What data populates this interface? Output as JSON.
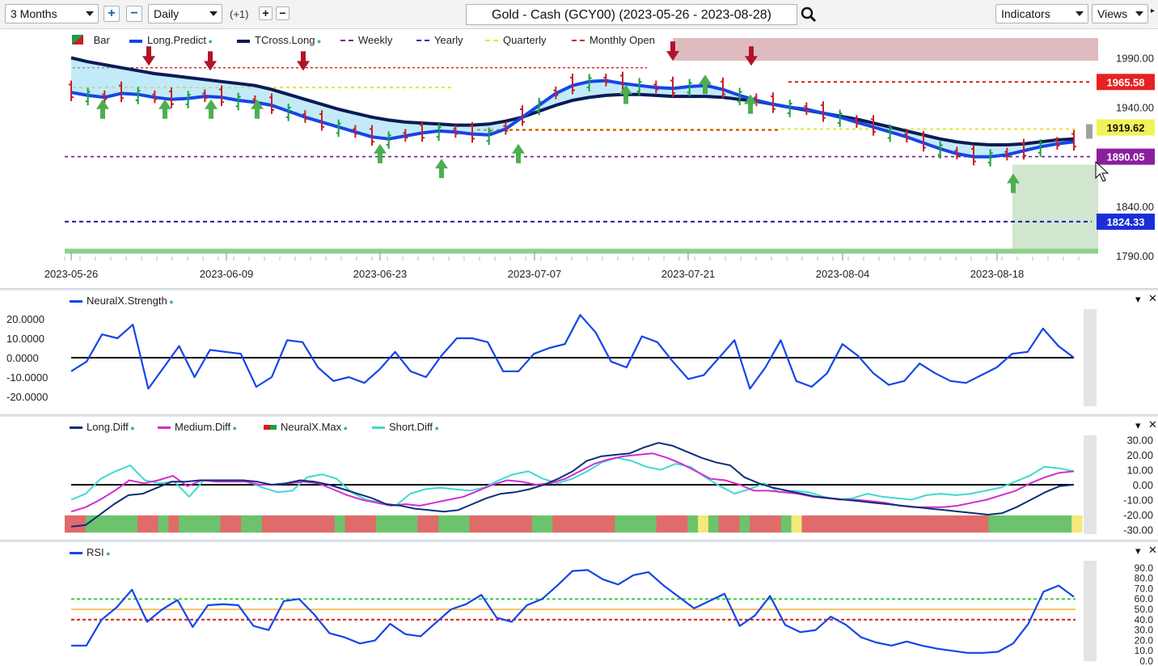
{
  "toolbar": {
    "range": "3 Months",
    "interval": "Daily",
    "offset": "(+1)",
    "symbol": "Gold - Cash (GCY00) (2023-05-26 - 2023-08-28)",
    "indicators": "Indicators",
    "views": "Views"
  },
  "main_legend": {
    "bar": "Bar",
    "long_predict": "Long.Predict",
    "tcross_long": "TCross.Long",
    "weekly": "Weekly",
    "yearly": "Yearly",
    "quarterly": "Quarterly",
    "monthly_open": "Monthly Open"
  },
  "price_axis": {
    "ticks": [
      "1990.00",
      "1940.00",
      "1890.00",
      "1840.00",
      "1790.00"
    ]
  },
  "price_tags": {
    "monthly_open": "1965.58",
    "last_price": "1919.62",
    "weekly": "1890.05",
    "yearly": "1824.33"
  },
  "date_axis": [
    "2023-05-26",
    "2023-06-09",
    "2023-06-23",
    "2023-07-07",
    "2023-07-21",
    "2023-08-04",
    "2023-08-18"
  ],
  "strength_pane": {
    "label": "NeuralX.Strength",
    "ticks": [
      "20.0000",
      "10.0000",
      "0.0000",
      "-10.0000",
      "-20.0000"
    ]
  },
  "diff_pane": {
    "labels": [
      "Long.Diff",
      "Medium.Diff",
      "NeuralX.Max",
      "Short.Diff"
    ],
    "ticks": [
      "30.00",
      "20.00",
      "10.00",
      "0.00",
      "-10.00",
      "-20.00",
      "-30.00"
    ]
  },
  "rsi_pane": {
    "label": "RSI",
    "ticks": [
      "90.0",
      "80.0",
      "70.0",
      "60.0",
      "50.0",
      "40.0",
      "30.0",
      "20.0",
      "10.0",
      "0.0"
    ]
  },
  "chart_data": [
    {
      "type": "line",
      "title": "Gold - Cash (GCY00) (2023-05-26 - 2023-08-28)",
      "x_start": "2023-05-26",
      "x_end": "2023-08-28",
      "ylim": [
        1785,
        2010
      ],
      "levels": {
        "monthly_open": 1965.58,
        "last": 1919.62,
        "weekly": 1890.05,
        "yearly": 1824.33
      },
      "series": [
        {
          "name": "Long.Predict",
          "values": [
            1955,
            1952,
            1950,
            1954,
            1953,
            1950,
            1948,
            1949,
            1951,
            1950,
            1947,
            1945,
            1942,
            1936,
            1930,
            1925,
            1920,
            1915,
            1910,
            1908,
            1911,
            1914,
            1916,
            1915,
            1913,
            1912,
            1918,
            1930,
            1942,
            1954,
            1962,
            1966,
            1967,
            1964,
            1962,
            1960,
            1959,
            1961,
            1962,
            1958,
            1952,
            1947,
            1943,
            1940,
            1938,
            1934,
            1930,
            1925,
            1920,
            1915,
            1910,
            1904,
            1898,
            1893,
            1890,
            1890,
            1892,
            1896,
            1900,
            1903,
            1905
          ]
        },
        {
          "name": "TCross.Long",
          "values": [
            1990,
            1986,
            1983,
            1980,
            1977,
            1974,
            1972,
            1970,
            1968,
            1966,
            1964,
            1962,
            1958,
            1953,
            1948,
            1943,
            1938,
            1934,
            1930,
            1927,
            1925,
            1924,
            1923,
            1922,
            1922,
            1923,
            1926,
            1930,
            1936,
            1942,
            1947,
            1950,
            1952,
            1953,
            1953,
            1952,
            1951,
            1951,
            1951,
            1950,
            1948,
            1946,
            1943,
            1940,
            1937,
            1934,
            1931,
            1928,
            1924,
            1920,
            1916,
            1912,
            1908,
            1905,
            1903,
            1902,
            1902,
            1903,
            1905,
            1907,
            1908
          ]
        }
      ]
    },
    {
      "type": "line",
      "title": "NeuralX.Strength",
      "ylim": [
        -25,
        25
      ],
      "series": [
        {
          "name": "NeuralX.Strength",
          "values": [
            -7,
            -2,
            12,
            10,
            17,
            -16,
            -5,
            6,
            -10,
            4,
            3,
            2,
            -15,
            -10,
            9,
            8,
            -5,
            -12,
            -10,
            -13,
            -6,
            3,
            -7,
            -10,
            1,
            10,
            10,
            8,
            -7,
            -7,
            2,
            5,
            7,
            22,
            13,
            -2,
            -5,
            11,
            8,
            -2,
            -11,
            -9,
            0,
            9,
            -16,
            -5,
            9,
            -12,
            -15,
            -8,
            7,
            1,
            -8,
            -14,
            -12,
            -3,
            -8,
            -12,
            -13,
            -9,
            -5,
            2,
            3,
            15,
            6,
            0
          ]
        }
      ]
    },
    {
      "type": "line",
      "title": "Diff",
      "ylim": [
        -33,
        33
      ],
      "series": [
        {
          "name": "Long.Diff",
          "values": [
            -28,
            -27,
            -20,
            -13,
            -7,
            -6,
            -2,
            2,
            2,
            3,
            3,
            3,
            3,
            2,
            0,
            1,
            3,
            2,
            0,
            -3,
            -6,
            -9,
            -13,
            -14,
            -16,
            -17,
            -18,
            -17,
            -13,
            -9,
            -6,
            -5,
            -3,
            0,
            4,
            9,
            16,
            19,
            20,
            21,
            25,
            28,
            26,
            22,
            18,
            15,
            13,
            5,
            1,
            -2,
            -4,
            -6,
            -8,
            -9,
            -10,
            -11,
            -12,
            -13,
            -14,
            -15,
            -16,
            -17,
            -18,
            -19,
            -20,
            -19,
            -15,
            -10,
            -5,
            -1,
            0
          ]
        },
        {
          "name": "Medium.Diff",
          "values": [
            -18,
            -15,
            -10,
            -4,
            3,
            1,
            3,
            6,
            -1,
            3,
            2,
            2,
            2,
            0,
            0,
            1,
            2,
            1,
            -3,
            -7,
            -10,
            -12,
            -14,
            -13,
            -14,
            -12,
            -10,
            -8,
            -4,
            0,
            3,
            2,
            0,
            1,
            4,
            9,
            14,
            17,
            19,
            20,
            21,
            18,
            14,
            9,
            4,
            3,
            0,
            -4,
            -4,
            -5,
            -6,
            -8,
            -9,
            -10,
            -10,
            -11,
            -12,
            -14,
            -15,
            -15,
            -15,
            -14,
            -12,
            -10,
            -7,
            -4,
            1,
            5,
            8,
            9
          ]
        },
        {
          "name": "Short.Diff",
          "values": [
            -10,
            -6,
            4,
            9,
            13,
            3,
            1,
            2,
            -8,
            3,
            3,
            3,
            2,
            -2,
            -5,
            -4,
            5,
            7,
            4,
            -5,
            -10,
            -12,
            -14,
            -6,
            -3,
            -2,
            -3,
            -4,
            -2,
            3,
            7,
            9,
            4,
            1,
            4,
            9,
            15,
            18,
            16,
            12,
            10,
            14,
            12,
            5,
            -1,
            -6,
            -3,
            1,
            -5,
            -4,
            -5,
            -8,
            -10,
            -9,
            -6,
            -8,
            -9,
            -10,
            -7,
            -6,
            -7,
            -6,
            -4,
            -2,
            2,
            6,
            12,
            11,
            9
          ]
        }
      ],
      "neuralx_max": [
        "red",
        "red",
        "green",
        "green",
        "green",
        "green",
        "green",
        "red",
        "red",
        "green",
        "red",
        "green",
        "green",
        "green",
        "green",
        "red",
        "red",
        "green",
        "green",
        "red",
        "red",
        "red",
        "red",
        "red",
        "red",
        "red",
        "green",
        "red",
        "red",
        "red",
        "green",
        "green",
        "green",
        "green",
        "red",
        "red",
        "green",
        "green",
        "green",
        "red",
        "red",
        "red",
        "red",
        "red",
        "red",
        "green",
        "green",
        "red",
        "red",
        "red",
        "red",
        "red",
        "red",
        "green",
        "green",
        "green",
        "green",
        "red",
        "red",
        "red",
        "green",
        "yellow",
        "green",
        "red",
        "red",
        "green",
        "red",
        "red",
        "red",
        "green",
        "yellow",
        "red",
        "red",
        "red",
        "red",
        "red",
        "red",
        "red",
        "red",
        "red",
        "red",
        "red",
        "red",
        "red",
        "red",
        "red",
        "red",
        "red",
        "red",
        "green",
        "green",
        "green",
        "green",
        "green",
        "green",
        "green",
        "green",
        "yellow"
      ]
    },
    {
      "type": "line",
      "title": "RSI",
      "ylim": [
        0,
        100
      ],
      "levels": [
        60,
        50,
        40
      ],
      "series": [
        {
          "name": "RSI",
          "values": [
            15,
            15,
            40,
            52,
            69,
            38,
            50,
            59,
            33,
            54,
            55,
            54,
            34,
            30,
            58,
            60,
            45,
            27,
            23,
            17,
            20,
            36,
            26,
            24,
            37,
            50,
            55,
            64,
            42,
            38,
            54,
            60,
            73,
            87,
            88,
            79,
            74,
            83,
            86,
            73,
            62,
            51,
            58,
            65,
            34,
            44,
            63,
            35,
            28,
            30,
            43,
            35,
            23,
            18,
            15,
            19,
            15,
            12,
            10,
            8,
            8,
            9,
            17,
            36,
            67,
            73,
            62
          ]
        }
      ]
    }
  ]
}
